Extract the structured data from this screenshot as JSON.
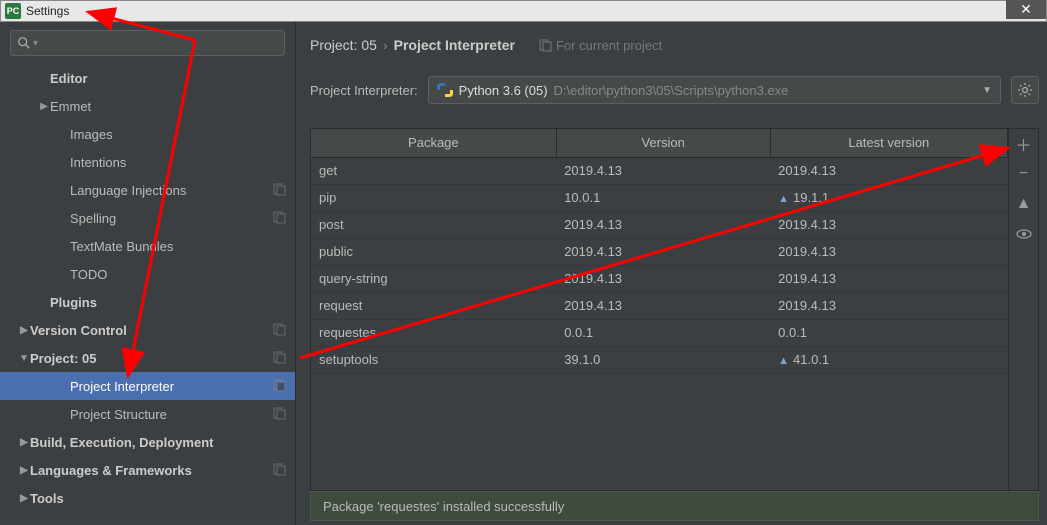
{
  "window": {
    "title": "Settings",
    "close": "✕"
  },
  "sidebar": {
    "items": [
      {
        "label": "Editor",
        "bold": true,
        "lvl": 1,
        "arrow": ""
      },
      {
        "label": "Emmet",
        "lvl": 1,
        "arrow": "▶"
      },
      {
        "label": "Images",
        "lvl": 2,
        "arrow": ""
      },
      {
        "label": "Intentions",
        "lvl": 2,
        "arrow": ""
      },
      {
        "label": "Language Injections",
        "lvl": 2,
        "arrow": "",
        "copy": true
      },
      {
        "label": "Spelling",
        "lvl": 2,
        "arrow": "",
        "copy": true
      },
      {
        "label": "TextMate Bundles",
        "lvl": 2,
        "arrow": ""
      },
      {
        "label": "TODO",
        "lvl": 2,
        "arrow": ""
      },
      {
        "label": "Plugins",
        "bold": true,
        "lvl": 1,
        "arrow": ""
      },
      {
        "label": "Version Control",
        "bold": true,
        "lvl": 0,
        "arrow": "▶",
        "copy": true
      },
      {
        "label": "Project: 05",
        "bold": true,
        "lvl": 0,
        "arrow": "▼",
        "copy": true
      },
      {
        "label": "Project Interpreter",
        "lvl": 2,
        "arrow": "",
        "selected": true,
        "copy": true
      },
      {
        "label": "Project Structure",
        "lvl": 2,
        "arrow": "",
        "copy": true
      },
      {
        "label": "Build, Execution, Deployment",
        "bold": true,
        "lvl": 0,
        "arrow": "▶"
      },
      {
        "label": "Languages & Frameworks",
        "bold": true,
        "lvl": 0,
        "arrow": "▶",
        "copy": true
      },
      {
        "label": "Tools",
        "bold": true,
        "lvl": 0,
        "arrow": "▶"
      }
    ]
  },
  "breadcrumb": {
    "prefix": "Project: 05",
    "sep": "›",
    "current": "Project Interpreter",
    "hint": "For current project"
  },
  "interpreter": {
    "label": "Project Interpreter:",
    "name": "Python 3.6 (05)",
    "path": "D:\\editor\\python3\\05\\Scripts\\python3.exe"
  },
  "packages": {
    "headers": [
      "Package",
      "Version",
      "Latest version"
    ],
    "rows": [
      {
        "name": "get",
        "version": "2019.4.13",
        "latest": "2019.4.13",
        "upgrade": false
      },
      {
        "name": "pip",
        "version": "10.0.1",
        "latest": "19.1.1",
        "upgrade": true
      },
      {
        "name": "post",
        "version": "2019.4.13",
        "latest": "2019.4.13",
        "upgrade": false
      },
      {
        "name": "public",
        "version": "2019.4.13",
        "latest": "2019.4.13",
        "upgrade": false
      },
      {
        "name": "query-string",
        "version": "2019.4.13",
        "latest": "2019.4.13",
        "upgrade": false
      },
      {
        "name": "request",
        "version": "2019.4.13",
        "latest": "2019.4.13",
        "upgrade": false
      },
      {
        "name": "requestes",
        "version": "0.0.1",
        "latest": "0.0.1",
        "upgrade": false
      },
      {
        "name": "setuptools",
        "version": "39.1.0",
        "latest": "41.0.1",
        "upgrade": true
      }
    ]
  },
  "status": {
    "message": "Package 'requestes' installed successfully"
  }
}
